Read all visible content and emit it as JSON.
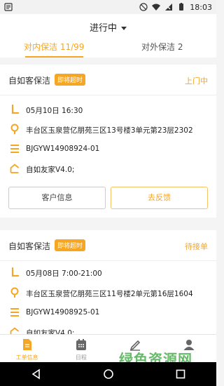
{
  "status_bar": {
    "time": "18:03"
  },
  "header": {
    "title": "进行中",
    "tabs": [
      {
        "label": "对内保洁 11/99"
      },
      {
        "label": "对外保洁 2"
      }
    ]
  },
  "cards": [
    {
      "title": "自如客保洁",
      "badge": "即将超时",
      "status": "上门中",
      "time": "05月10日 16:30",
      "address": "丰台区玉泉营亿朋苑三区13号楼3单元第23层2302",
      "order_no": "BJGYW14908924-01",
      "source": "自如友家V4.0;",
      "btn_info": "客户信息",
      "btn_feedback": "去反馈"
    },
    {
      "title": "自如客保洁",
      "badge": "即将超时",
      "status": "待接单",
      "time": "05月08日 7:00-21:00",
      "address": "丰台区玉泉营亿朋苑三区11号楼2单元第16层1604",
      "order_no": "BJGYW14908925-01",
      "source": "自如友家V4.0;"
    }
  ],
  "bottom_nav": [
    {
      "label": "工单信息",
      "icon": "document-icon"
    },
    {
      "label": "日程",
      "icon": "calendar-icon"
    },
    {
      "label": "",
      "icon": "edit-icon"
    },
    {
      "label": "",
      "icon": "user-icon"
    }
  ],
  "watermark": {
    "main": "绿色资源网",
    "sub": "www.downcc.com"
  },
  "colors": {
    "accent": "#f5a623",
    "badge": "#f5a623",
    "watermark": "#4caf50"
  }
}
